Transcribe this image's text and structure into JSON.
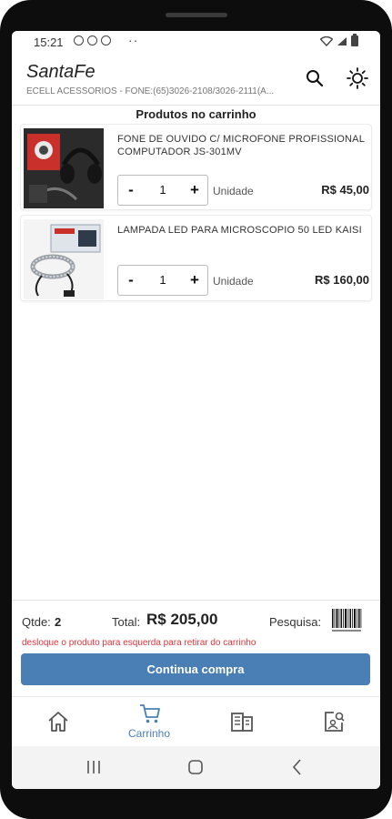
{
  "status": {
    "time": "15:21",
    "dots": "··"
  },
  "app": {
    "title": "SantaFe",
    "subtitle": "ECELL ACESSORIOS - FONE:(65)3026-2108/3026-2111(A..."
  },
  "cart": {
    "section_title": "Produtos no carrinho",
    "items": [
      {
        "name": "FONE DE OUVIDO C/ MICROFONE PROFISSIONAL COMPUTADOR JS-301MV",
        "minus": "-",
        "qty": "1",
        "plus": "+",
        "unit": "Unidade",
        "price": "R$ 45,00"
      },
      {
        "name": "LAMPADA LED PARA MICROSCOPIO 50 LED KAISI",
        "minus": "-",
        "qty": "1",
        "plus": "+",
        "unit": "Unidade",
        "price": "R$ 160,00"
      }
    ]
  },
  "summary": {
    "qtde_label": "Qtde:",
    "qtde_value": "2",
    "total_label": "Total:",
    "total_value": "R$ 205,00",
    "search_label": "Pesquisa:",
    "hint": "desloque o produto para esquerda para retirar do carrinho",
    "continue_label": "Continua compra"
  },
  "nav": {
    "items": [
      {
        "label": "",
        "icon": "home-icon"
      },
      {
        "label": "Carrinho",
        "icon": "cart-icon"
      },
      {
        "label": "",
        "icon": "catalog-icon"
      },
      {
        "label": "",
        "icon": "profile-search-icon"
      }
    ]
  },
  "colors": {
    "accent": "#4a7fb5",
    "hint": "#e0353b"
  }
}
